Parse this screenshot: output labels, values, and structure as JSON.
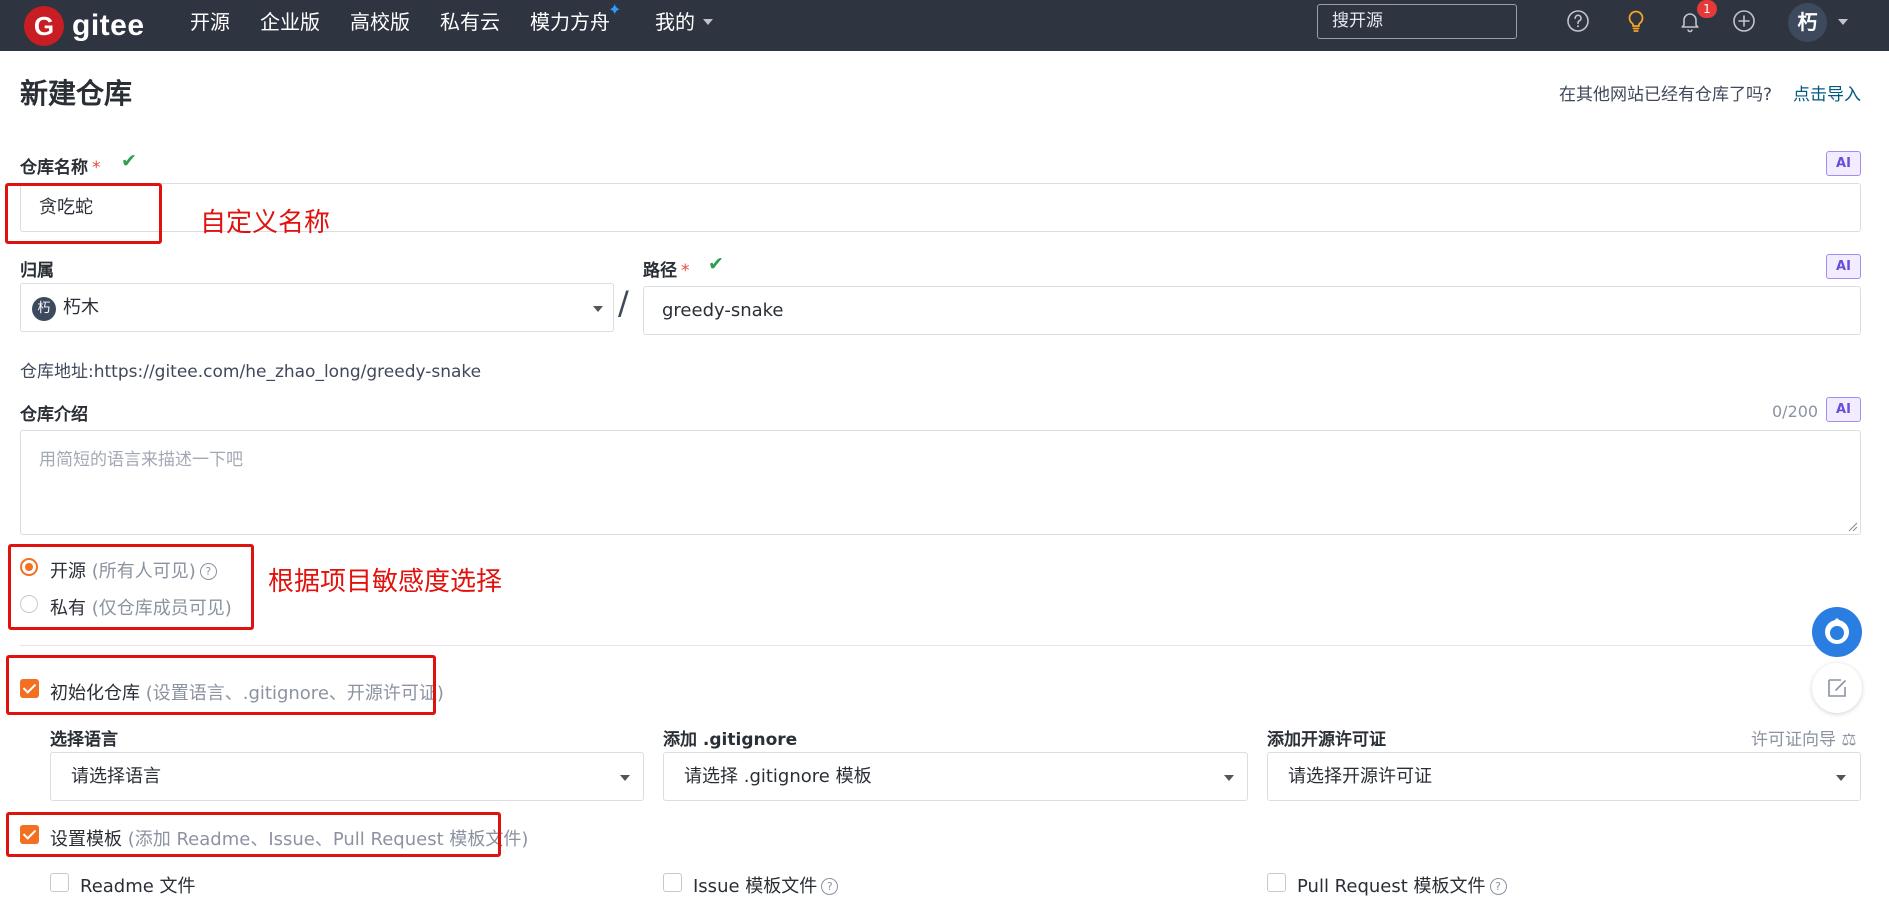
{
  "nav": {
    "logo_letter": "G",
    "logo_text": "gitee",
    "items": [
      "开源",
      "企业版",
      "高校版",
      "私有云",
      "模力方舟",
      "我的"
    ],
    "search_placeholder": "搜开源",
    "notification_count": "1",
    "avatar_text": "朽"
  },
  "page": {
    "title": "新建仓库",
    "import_hint": "在其他网站已经有仓库了吗?",
    "import_link": "点击导入"
  },
  "form": {
    "repo_name_label": "仓库名称",
    "required_mark": "*",
    "ai_label": "AI",
    "repo_name_value": "贪吃蛇",
    "owner_label": "归属",
    "owner_avatar": "朽",
    "owner_value": "朽木",
    "path_sep": "/",
    "path_label": "路径",
    "path_value": "greedy-snake",
    "repo_url_prefix": "仓库地址:",
    "repo_url": "https://gitee.com/he_zhao_long/greedy-snake",
    "intro_label": "仓库介绍",
    "intro_count": "0/200",
    "intro_placeholder": "用简短的语言来描述一下吧",
    "visibility": {
      "public_label": "开源",
      "public_desc": "(所有人可见)",
      "private_label": "私有",
      "private_desc": "(仅仓库成员可见)",
      "selected": "public"
    },
    "init_repo": {
      "label": "初始化仓库",
      "desc": "(设置语言、.gitignore、开源许可证)",
      "checked": true
    },
    "language_label": "选择语言",
    "language_placeholder": "请选择语言",
    "gitignore_label": "添加 .gitignore",
    "gitignore_placeholder": "请选择 .gitignore 模板",
    "license_label": "添加开源许可证",
    "license_guide": "许可证向导",
    "license_placeholder": "请选择开源许可证",
    "template": {
      "label": "设置模板",
      "desc": "(添加 Readme、Issue、Pull Request 模板文件)",
      "checked": true
    },
    "template_files": [
      "Readme 文件",
      "Issue 模板文件",
      "Pull Request 模板文件"
    ]
  },
  "annotations": {
    "name_note": "自定义名称",
    "visibility_note": "根据项目敏感度选择"
  },
  "colors": {
    "accent": "#f36f21",
    "navbar": "#2e3440",
    "annotation_red": "#e0120e",
    "link": "#005980"
  }
}
